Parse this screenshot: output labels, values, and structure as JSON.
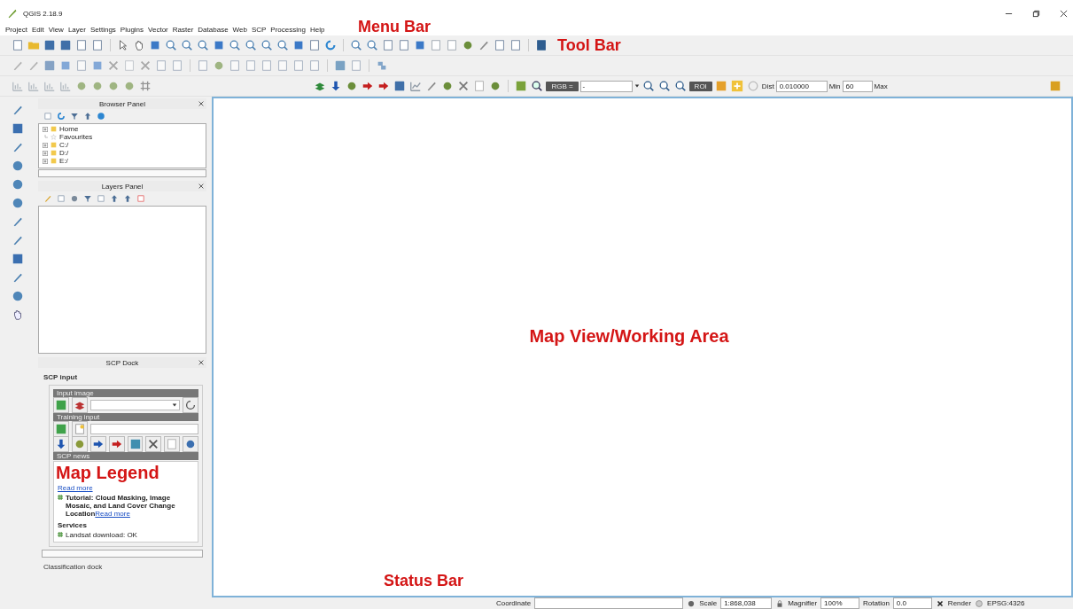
{
  "window": {
    "title": "QGIS 2.18.9"
  },
  "menu_bar": [
    "Project",
    "Edit",
    "View",
    "Layer",
    "Settings",
    "Plugins",
    "Vector",
    "Raster",
    "Database",
    "Web",
    "SCP",
    "Processing",
    "Help"
  ],
  "scp_toolbar": {
    "rgb_label": "RGB =",
    "rgb_value": "-",
    "roi_label": "ROI",
    "dist_label": "Dist",
    "dist_value": "0.010000",
    "min_label": "Min",
    "min_value": "60",
    "max_label": "Max"
  },
  "browser_panel": {
    "title": "Browser Panel",
    "items": [
      {
        "label": "Home",
        "expandable": true
      },
      {
        "label": "Favourites",
        "expandable": false
      },
      {
        "label": "C:/",
        "expandable": true
      },
      {
        "label": "D:/",
        "expandable": true
      },
      {
        "label": "E:/",
        "expandable": true
      }
    ]
  },
  "layers_panel": {
    "title": "Layers Panel"
  },
  "scp_dock": {
    "title": "SCP Dock",
    "tabs": [
      {
        "label": "SCP input",
        "selected": true
      },
      {
        "label": "Classification dock",
        "selected": false
      }
    ],
    "input_image": "Input image",
    "training_input": "Training input",
    "news_title": "SCP news",
    "first_link": "Read more",
    "news_items": [
      {
        "headline": "Tutorial: Cloud Masking, Image Mosaic, and Land Cover Change Location",
        "link": "Read more"
      }
    ],
    "services_title": "Services",
    "services": [
      "Landsat download: OK"
    ]
  },
  "status_bar": {
    "coordinate_label": "Coordinate",
    "scale_label": "Scale",
    "scale_value": "1:868,038",
    "magnifier_label": "Magnifier",
    "magnifier_value": "100%",
    "rotation_label": "Rotation",
    "rotation_value": "0.0",
    "render_label": "Render",
    "render_checked": true,
    "crs": "EPSG:4326"
  },
  "annotations": {
    "menu_bar": "Menu Bar",
    "tool_bar": "Tool Bar",
    "map_view": "Map View/Working Area",
    "map_legend": "Map Legend",
    "status_bar": "Status Bar"
  }
}
